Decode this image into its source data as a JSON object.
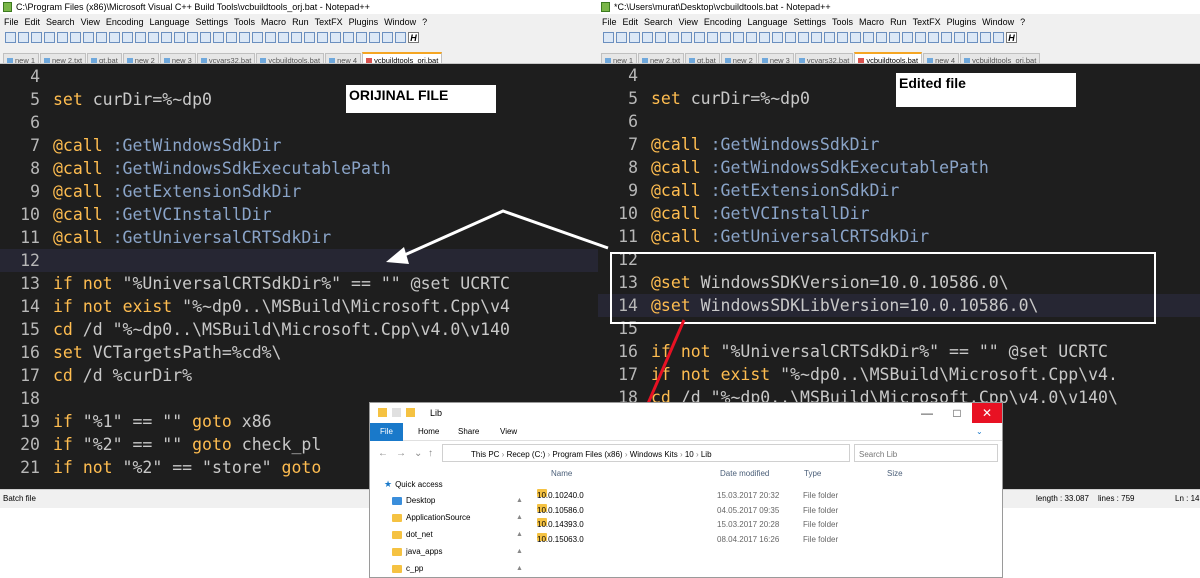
{
  "left_window": {
    "title": "C:\\Program Files (x86)\\Microsoft Visual C++ Build Tools\\vcbuildtools_orj.bat - Notepad++",
    "menu": [
      "File",
      "Edit",
      "Search",
      "View",
      "Encoding",
      "Language",
      "Settings",
      "Tools",
      "Macro",
      "Run",
      "TextFX",
      "Plugins",
      "Window",
      "?"
    ],
    "tabs": [
      "new 1",
      "new 2.txt",
      "qt.bat",
      "new 2",
      "new 3",
      "vcvars32.bat",
      "vcbuildtools.bat",
      "new 4",
      "vcbuildtools_orj.bat"
    ],
    "active_tab": 8,
    "label": "ORIJINAL FILE",
    "lines": [
      {
        "n": "4",
        "t": ""
      },
      {
        "n": "5",
        "t": "set curDir=%~dp0"
      },
      {
        "n": "6",
        "t": ""
      },
      {
        "n": "7",
        "t": "@call :GetWindowsSdkDir"
      },
      {
        "n": "8",
        "t": "@call :GetWindowsSdkExecutablePath"
      },
      {
        "n": "9",
        "t": "@call :GetExtensionSdkDir"
      },
      {
        "n": "10",
        "t": "@call :GetVCInstallDir"
      },
      {
        "n": "11",
        "t": "@call :GetUniversalCRTSdkDir"
      },
      {
        "n": "12",
        "t": ""
      },
      {
        "n": "13",
        "t": "if not \"%UniversalCRTSdkDir%\" == \"\" @set UCRTC"
      },
      {
        "n": "14",
        "t": "if not exist \"%~dp0..\\MSBuild\\Microsoft.Cpp\\v4"
      },
      {
        "n": "15",
        "t": "cd /d \"%~dp0..\\MSBuild\\Microsoft.Cpp\\v4.0\\v140"
      },
      {
        "n": "16",
        "t": "set VCTargetsPath=%cd%\\"
      },
      {
        "n": "17",
        "t": "cd /d %curDir%"
      },
      {
        "n": "18",
        "t": ""
      },
      {
        "n": "19",
        "t": "if \"%1\" == \"\" goto x86"
      },
      {
        "n": "20",
        "t": "if \"%2\" == \"\" goto check_pl"
      },
      {
        "n": "21",
        "t": "if not \"%2\" == \"store\" goto"
      }
    ]
  },
  "right_window": {
    "title": "*C:\\Users\\murat\\Desktop\\vcbuildtools.bat - Notepad++",
    "menu": [
      "File",
      "Edit",
      "Search",
      "View",
      "Encoding",
      "Language",
      "Settings",
      "Tools",
      "Macro",
      "Run",
      "TextFX",
      "Plugins",
      "Window",
      "?"
    ],
    "tabs": [
      "new 1",
      "new 2.txt",
      "qt.bat",
      "new 2",
      "new 3",
      "vcvars32.bat",
      "vcbuildtools.bat",
      "new 4",
      "vcbuildtools_orj.bat"
    ],
    "active_tab": 6,
    "label": "Edited file",
    "lines": [
      {
        "n": "4",
        "t": ""
      },
      {
        "n": "5",
        "t": "set curDir=%~dp0"
      },
      {
        "n": "6",
        "t": ""
      },
      {
        "n": "7",
        "t": "@call :GetWindowsSdkDir"
      },
      {
        "n": "8",
        "t": "@call :GetWindowsSdkExecutablePath"
      },
      {
        "n": "9",
        "t": "@call :GetExtensionSdkDir"
      },
      {
        "n": "10",
        "t": "@call :GetVCInstallDir"
      },
      {
        "n": "11",
        "t": "@call :GetUniversalCRTSdkDir"
      },
      {
        "n": "12",
        "t": ""
      },
      {
        "n": "13",
        "t": "@set WindowsSDKVersion=10.0.10586.0\\"
      },
      {
        "n": "14",
        "t": "@set WindowsSDKLibVersion=10.0.10586.0\\"
      },
      {
        "n": "15",
        "t": ""
      },
      {
        "n": "16",
        "t": "if not \"%UniversalCRTSdkDir%\" == \"\" @set UCRTC"
      },
      {
        "n": "17",
        "t": "if not exist \"%~dp0..\\MSBuild\\Microsoft.Cpp\\v4."
      },
      {
        "n": "18",
        "t": "cd /d \"%~dp0..\\MSBuild\\Microsoft.Cpp\\v4.0\\v140\\"
      }
    ]
  },
  "status": {
    "left": "Batch file",
    "length": "length : 33.087",
    "lines": "lines : 759",
    "ln": "Ln : 14"
  },
  "explorer": {
    "title": "Lib",
    "ribbon": [
      "File",
      "Home",
      "Share",
      "View"
    ],
    "path": [
      "This PC",
      "Recep (C:)",
      "Program Files (x86)",
      "Windows Kits",
      "10",
      "Lib"
    ],
    "search_placeholder": "Search Lib",
    "columns": [
      "Name",
      "Date modified",
      "Type",
      "Size"
    ],
    "sidebar": [
      "Quick access",
      "Desktop",
      "ApplicationSource",
      "dot_net",
      "java_apps",
      "c_pp"
    ],
    "rows": [
      {
        "name": "10.0.10240.0",
        "date": "15.03.2017 20:32",
        "type": "File folder"
      },
      {
        "name": "10.0.10586.0",
        "date": "04.05.2017 09:35",
        "type": "File folder"
      },
      {
        "name": "10.0.14393.0",
        "date": "15.03.2017 20:28",
        "type": "File folder"
      },
      {
        "name": "10.0.15063.0",
        "date": "08.04.2017 16:26",
        "type": "File folder"
      }
    ]
  },
  "colors": {
    "editor_bg": "#1e1e1e",
    "keyword": "#ffbd50",
    "function": "#8aa4c8",
    "arrow": "#ffffff",
    "red_line": "#e81123"
  }
}
